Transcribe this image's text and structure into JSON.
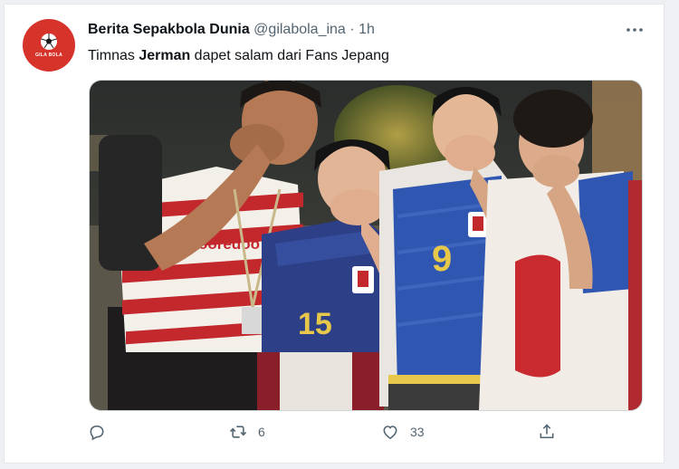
{
  "tweet": {
    "author_name": "Berita Sepakbola Dunia",
    "handle": "@gilabola_ina",
    "separator": "·",
    "time": "1h",
    "text_before": "Timnas ",
    "text_bold": "Jerman",
    "text_after": " dapet salam dari Fans Jepang",
    "avatar_label": "GILA BOLA"
  },
  "media": {
    "jersey_numbers": [
      "15",
      "9"
    ],
    "shirt_text": "ooredoo"
  },
  "actions": {
    "reply_count": "",
    "retweet_count": "6",
    "like_count": "33",
    "share_count": ""
  },
  "colors": {
    "accent_red": "#d6342b",
    "japan_blue": "#2d4fa0",
    "muted_text": "#536471"
  },
  "icons": [
    "more-icon",
    "reply-icon",
    "retweet-icon",
    "like-icon",
    "share-icon"
  ]
}
